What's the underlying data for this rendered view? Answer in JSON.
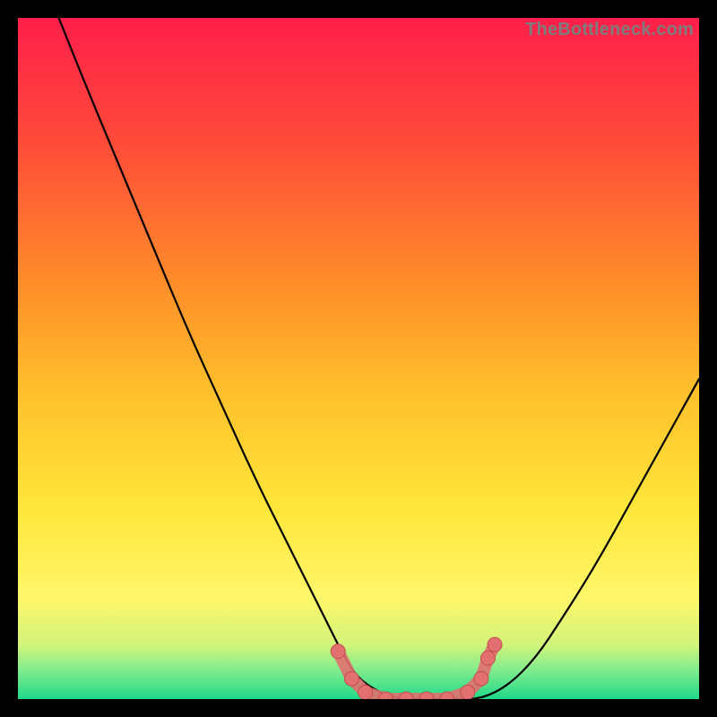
{
  "watermark": "TheBottleneck.com",
  "colors": {
    "bg": "#000000",
    "grad_top": "#ff1f4a",
    "grad_mid1": "#ff7a2a",
    "grad_mid2": "#ffd633",
    "grad_low": "#fff14a",
    "grad_bottom1": "#d7f56a",
    "grad_bottom2": "#2ce28b",
    "curve": "#000000",
    "marker_fill": "#e27070",
    "marker_stroke": "#c24d4d"
  },
  "chart_data": {
    "type": "line",
    "title": "",
    "xlabel": "",
    "ylabel": "",
    "xlim": [
      0,
      100
    ],
    "ylim": [
      0,
      100
    ],
    "series": [
      {
        "name": "bottleneck-curve",
        "x": [
          6,
          10,
          15,
          20,
          25,
          30,
          35,
          40,
          45,
          48,
          50,
          53,
          56,
          60,
          64,
          68,
          72,
          76,
          80,
          85,
          90,
          95,
          100
        ],
        "y": [
          100,
          90,
          78,
          66,
          54,
          43,
          32,
          22,
          12,
          6,
          3,
          1,
          0,
          0,
          0,
          0,
          2,
          6,
          12,
          20,
          29,
          38,
          47
        ]
      }
    ],
    "markers": {
      "name": "highlight-points",
      "x": [
        47,
        49,
        51,
        54,
        57,
        60,
        63,
        66,
        68,
        69,
        70
      ],
      "y": [
        7,
        3,
        1,
        0,
        0,
        0,
        0,
        1,
        3,
        6,
        8
      ]
    }
  }
}
